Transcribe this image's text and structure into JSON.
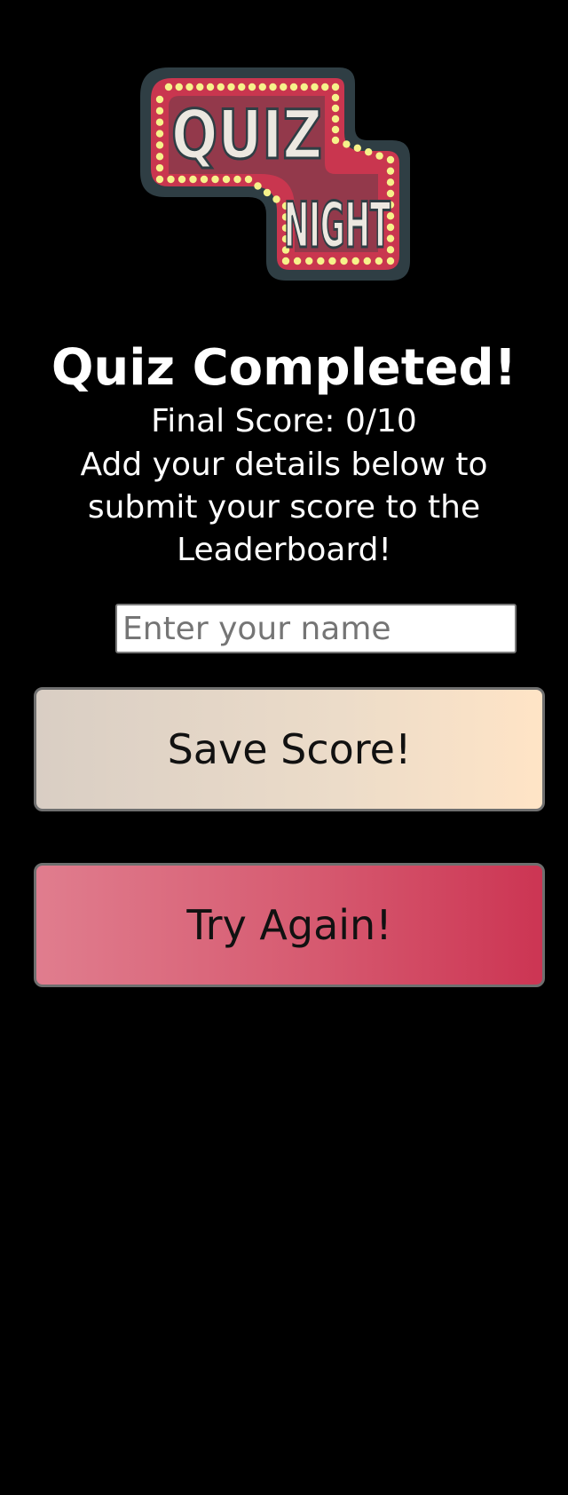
{
  "logo": {
    "line1": "QUIZ",
    "line2": "NIGHT",
    "colors": {
      "outer": "#2f3e44",
      "frame": "#c9364f",
      "bulb": "#f6f28a",
      "text": "#ece8e0"
    }
  },
  "heading": "Quiz Completed!",
  "score_text": "Final Score: 0/10",
  "instructions": "Add your details below to submit your score to the Leaderboard!",
  "name_input": {
    "placeholder": "Enter your name",
    "value": ""
  },
  "buttons": {
    "save_label": "Save Score!",
    "retry_label": "Try Again!"
  },
  "colors": {
    "background": "#000000",
    "save_gradient": [
      "#d9cec4",
      "#ffe4c6"
    ],
    "retry_gradient": [
      "#e07d8e",
      "#cc3553"
    ]
  }
}
